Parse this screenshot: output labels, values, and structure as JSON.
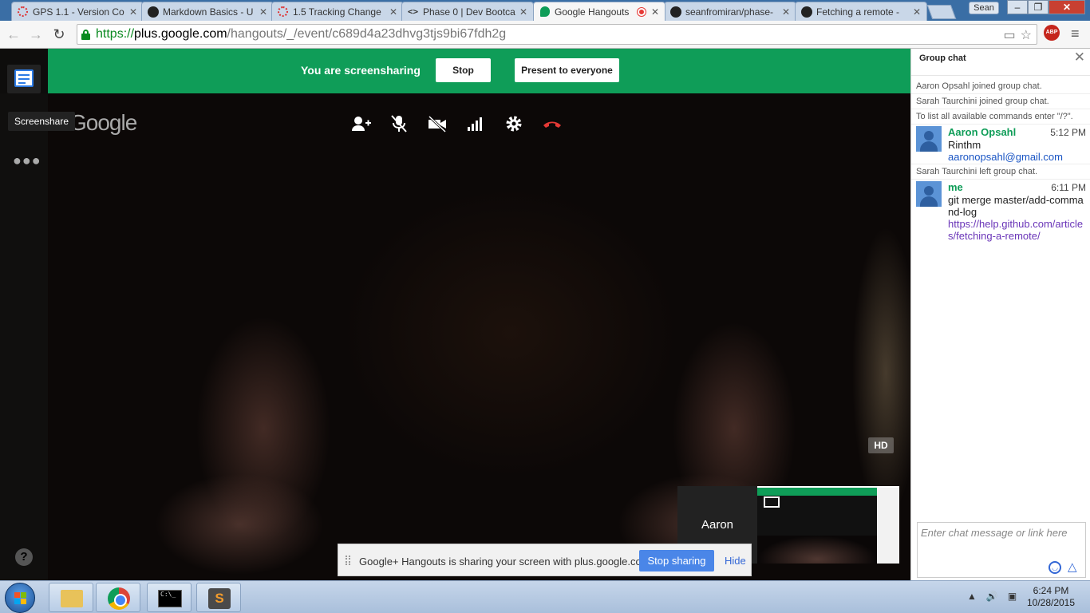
{
  "browser": {
    "tabs": [
      {
        "title": "GPS 1.1 - Version Co",
        "icon": "loading-icon"
      },
      {
        "title": "Markdown Basics - U",
        "icon": "github-icon"
      },
      {
        "title": "1.5 Tracking Change",
        "icon": "loading-icon"
      },
      {
        "title": "Phase 0 | Dev Bootca",
        "icon": "code-icon"
      },
      {
        "title": "Google Hangouts",
        "icon": "hangouts-icon",
        "active": true,
        "recording": true
      },
      {
        "title": "seanfromiran/phase-",
        "icon": "github-icon"
      },
      {
        "title": "Fetching a remote - ",
        "icon": "github-icon"
      }
    ],
    "profile_name": "Sean",
    "url_scheme": "https://",
    "url_host": "plus.google.com",
    "url_path": "/hangouts/_/event/c689d4a23dhvg3tjs9bi67fdh2g",
    "abp_label": "ABP"
  },
  "hangout": {
    "banner_text": "You are screensharing",
    "stop_label": "Stop",
    "present_label": "Present to everyone",
    "tooltip": "Screenshare",
    "logo_text": "Google",
    "hd_label": "HD",
    "filmstrip_name": "Aaron",
    "share_notice": {
      "text": "Google+ Hangouts is sharing your screen with plus.google.com.",
      "stop_label": "Stop sharing",
      "hide_label": "Hide"
    }
  },
  "chat": {
    "title": "Group chat",
    "system_messages": [
      "Aaron Opsahl joined group chat.",
      "Sarah Taurchini joined group chat.",
      "To list all available commands enter \"/?\"."
    ],
    "messages": [
      {
        "sender": "Aaron Opsahl",
        "time": "5:12 PM",
        "lines": [
          "Rinthm"
        ],
        "link": "aaronopsahl@gmail.com"
      },
      {
        "sender": "me",
        "time": "6:11 PM",
        "lines": [
          "git merge master/add-command-log"
        ],
        "link": "https://help.github.com/articles/fetching-a-remote/"
      }
    ],
    "left_message": "Sarah Taurchini left group chat.",
    "input_placeholder": "Enter chat message or link here"
  },
  "taskbar": {
    "time": "6:24 PM",
    "date": "10/28/2015",
    "cmd_label": "C:\\_"
  },
  "colors": {
    "hangouts_green": "#0f9d58",
    "accent_blue": "#4a86e8",
    "record_red": "#e53935"
  }
}
